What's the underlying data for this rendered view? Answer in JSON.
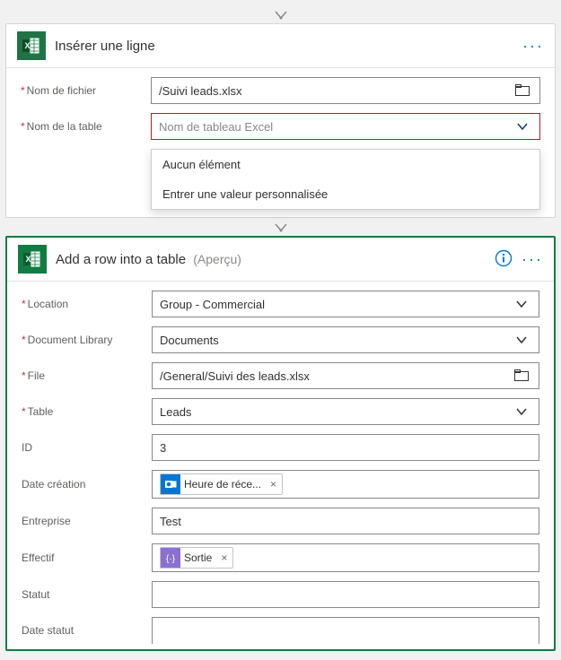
{
  "card1": {
    "title": "Insérer une ligne",
    "fields": {
      "file_label": "Nom de fichier",
      "file_value": "/Suivi leads.xlsx",
      "table_label": "Nom de la table",
      "table_placeholder": "Nom de tableau Excel"
    },
    "dropdown": {
      "option1": "Aucun élément",
      "option2": "Entrer une valeur personnalisée"
    }
  },
  "card2": {
    "title": "Add a row into a table",
    "preview": "(Aperçu)",
    "fields": {
      "location_label": "Location",
      "location_value": "Group - Commercial",
      "library_label": "Document Library",
      "library_value": "Documents",
      "file_label": "File",
      "file_value": "/General/Suivi des leads.xlsx",
      "table_label": "Table",
      "table_value": "Leads",
      "id_label": "ID",
      "id_value": "3",
      "date_label": "Date création",
      "date_token": "Heure de réce...",
      "entreprise_label": "Entreprise",
      "entreprise_value": "Test",
      "effectif_label": "Effectif",
      "effectif_token": "Sortie",
      "statut_label": "Statut",
      "datestatut_label": "Date statut"
    }
  }
}
